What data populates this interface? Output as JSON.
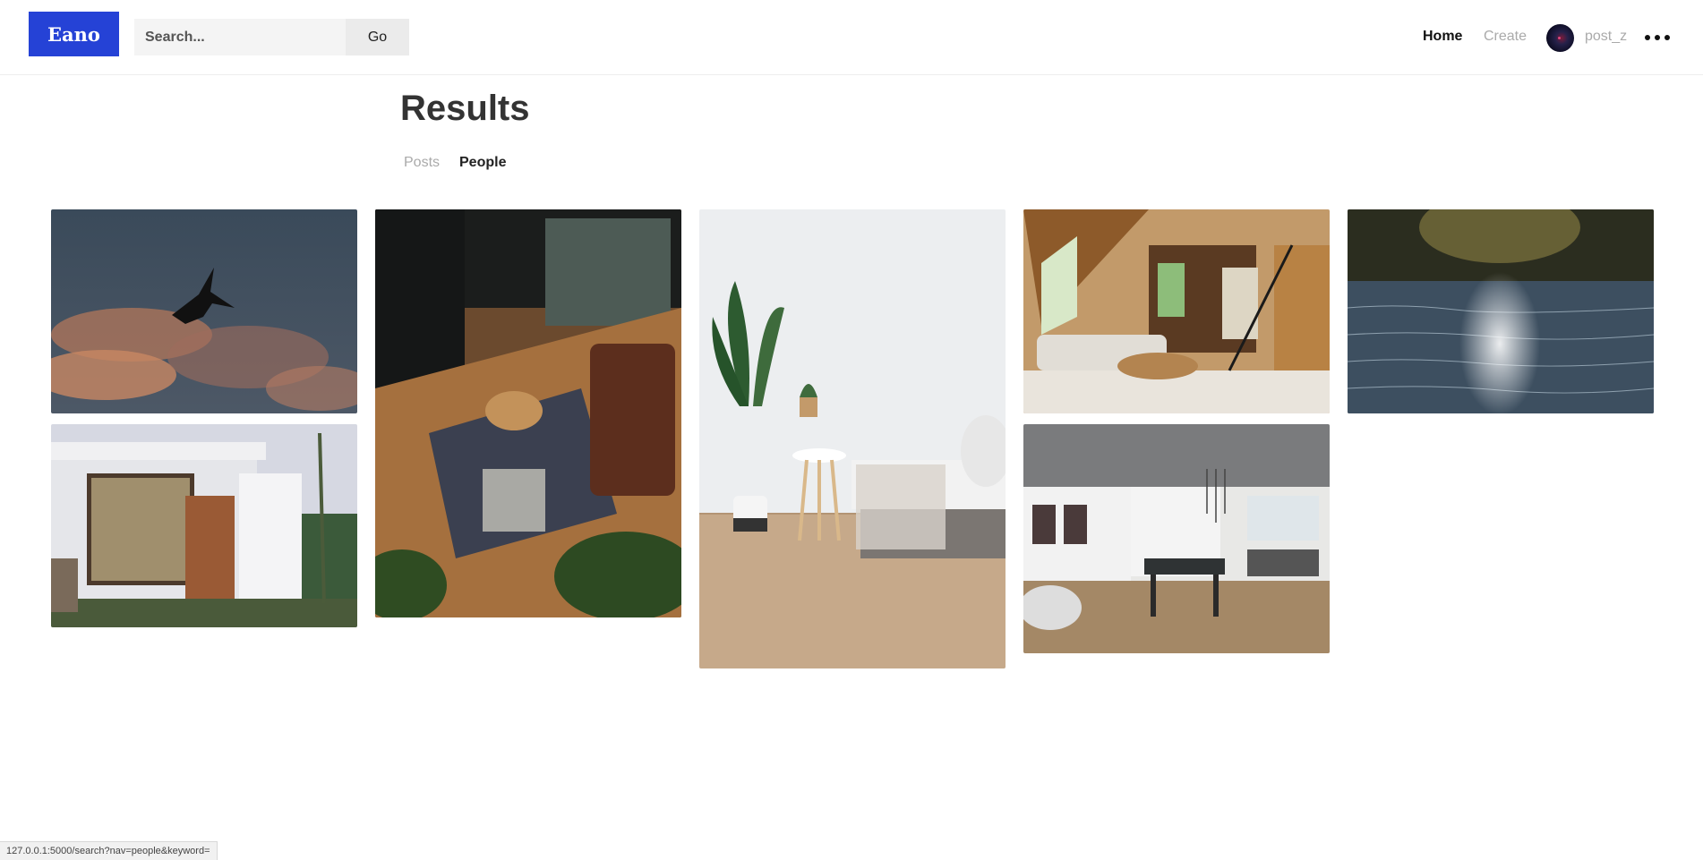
{
  "header": {
    "logo": "Eano",
    "search_placeholder": "Search...",
    "search_value": "",
    "go_label": "Go",
    "nav": {
      "home": "Home",
      "create": "Create"
    },
    "username": "post_z",
    "menu_icon": "more-dots-icon"
  },
  "main": {
    "title": "Results",
    "tabs": [
      {
        "label": "Posts",
        "active": false
      },
      {
        "label": "People",
        "active": true
      }
    ]
  },
  "images": [
    {
      "subject": "bird silhouette against cloudy sky"
    },
    {
      "subject": "modern house exterior at dusk"
    },
    {
      "subject": "living room with leather sofa and fireplace"
    },
    {
      "subject": "plants and side table beside bed"
    },
    {
      "subject": "A-frame cabin living room"
    },
    {
      "subject": "grey dining room with black table"
    },
    {
      "subject": "sunlight reflecting on lake water"
    }
  ],
  "status_bar": "127.0.0.1:5000/search?nav=people&keyword=",
  "colors": {
    "brand": "#2542d6",
    "muted": "#aaaaaa"
  }
}
